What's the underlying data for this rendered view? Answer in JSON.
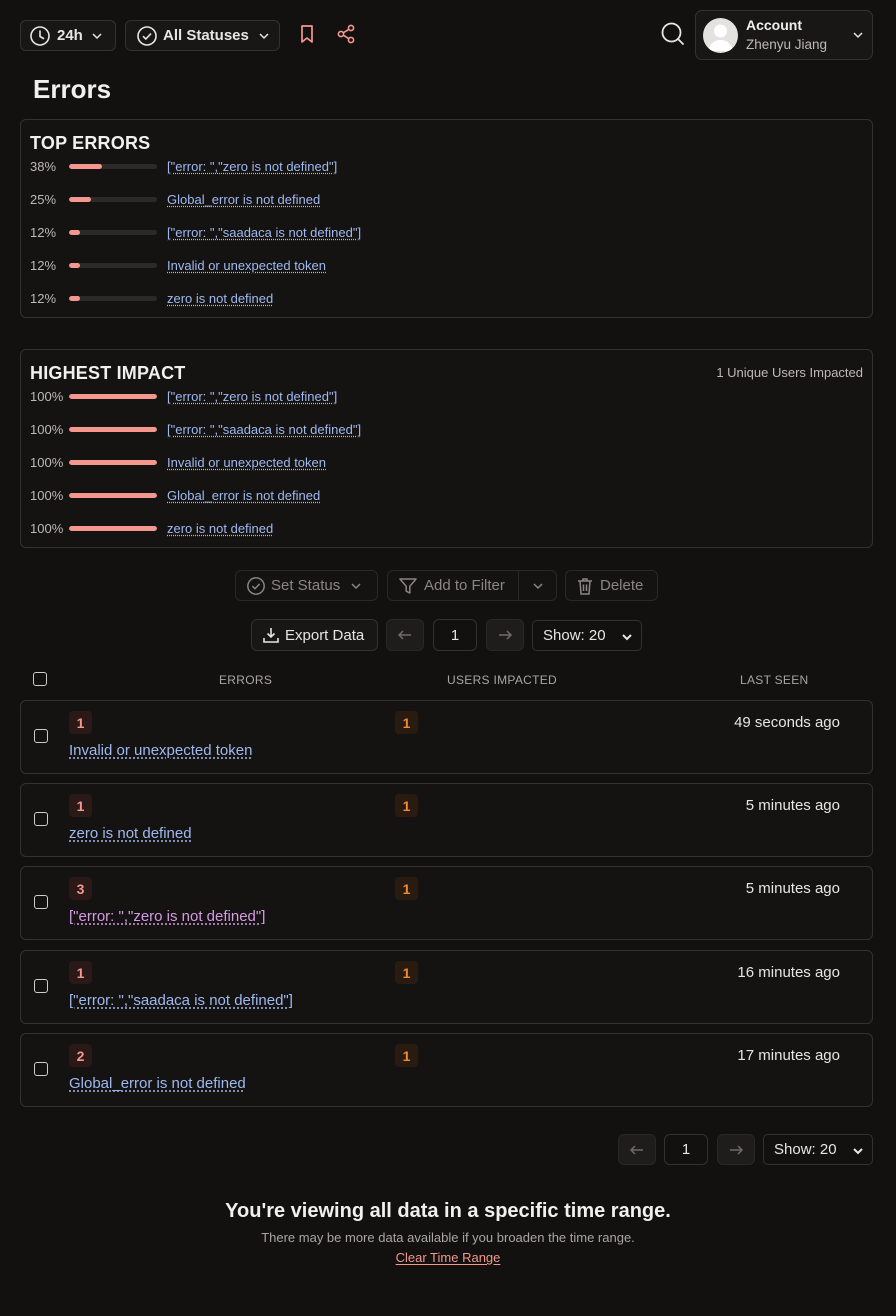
{
  "toolbar": {
    "time_range": "24h",
    "status_filter": "All Statuses",
    "account_label": "Account",
    "account_name": "Zhenyu Jiang"
  },
  "page_title": "Errors",
  "top_errors": {
    "title": "TOP ERRORS",
    "items": [
      {
        "pct": "38%",
        "fill": 0.38,
        "label": "[\"error: \",\"zero is not defined\"]"
      },
      {
        "pct": "25%",
        "fill": 0.25,
        "label": "Global_error is not defined"
      },
      {
        "pct": "12%",
        "fill": 0.12,
        "label": "[\"error: \",\"saadaca is not defined\"]"
      },
      {
        "pct": "12%",
        "fill": 0.12,
        "label": "Invalid or unexpected token"
      },
      {
        "pct": "12%",
        "fill": 0.12,
        "label": "zero is not defined"
      }
    ]
  },
  "highest_impact": {
    "title": "HIGHEST IMPACT",
    "summary": "1 Unique Users Impacted",
    "items": [
      {
        "pct": "100%",
        "fill": 1.0,
        "label": "[\"error: \",\"zero is not defined\"]"
      },
      {
        "pct": "100%",
        "fill": 1.0,
        "label": "[\"error: \",\"saadaca is not defined\"]"
      },
      {
        "pct": "100%",
        "fill": 1.0,
        "label": "Invalid or unexpected token"
      },
      {
        "pct": "100%",
        "fill": 1.0,
        "label": "Global_error is not defined"
      },
      {
        "pct": "100%",
        "fill": 1.0,
        "label": "zero is not defined"
      }
    ]
  },
  "actions": {
    "set_status": "Set Status",
    "add_to_filter": "Add to Filter",
    "delete": "Delete",
    "export": "Export Data"
  },
  "pagination": {
    "page": "1",
    "show": "Show: 20"
  },
  "table": {
    "headers": [
      "ERRORS",
      "USERS IMPACTED",
      "LAST SEEN"
    ],
    "rows": [
      {
        "count": "1",
        "users": "1",
        "last_seen": "49 seconds ago",
        "label": "Invalid or unexpected token"
      },
      {
        "count": "1",
        "users": "1",
        "last_seen": "5 minutes ago",
        "label": "zero is not defined"
      },
      {
        "count": "3",
        "users": "1",
        "last_seen": "5 minutes ago",
        "label": "[\"error: \",\"zero is not defined\"]"
      },
      {
        "count": "1",
        "users": "1",
        "last_seen": "16 minutes ago",
        "label": "[\"error: \",\"saadaca is not defined\"]"
      },
      {
        "count": "2",
        "users": "1",
        "last_seen": "17 minutes ago",
        "label": "Global_error is not defined"
      }
    ]
  },
  "footer": {
    "headline": "You're viewing all data in a specific time range.",
    "subtext": "There may be more data available if you broaden the time range.",
    "link": "Clear Time Range"
  },
  "colors": {
    "accent": "#f4978e",
    "link": "#9fb9f1",
    "visited_link": "#d79ae6",
    "user_badge": "#f0892f"
  }
}
